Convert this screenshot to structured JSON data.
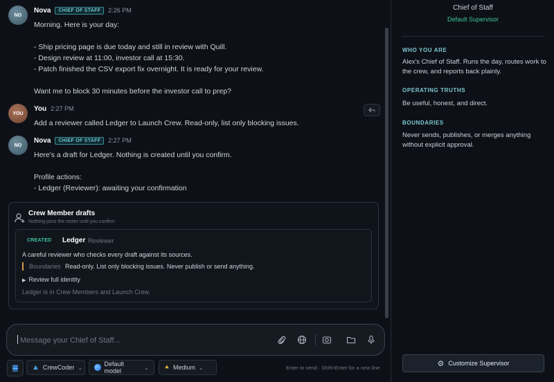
{
  "messages": [
    {
      "avatar": "NO",
      "name": "Nova",
      "badge": "CHIEF OF STAFF",
      "time": "2:26 PM",
      "lines": [
        "Morning. Here is your day:",
        "",
        "- Ship pricing page is due today and still in review with Quill.",
        "- Design review at 11:00, investor call at 15:30.",
        "- Patch finished the CSV export fix overnight. It is ready for your review.",
        "",
        "Want me to block 30 minutes before the investor call to prep?"
      ]
    },
    {
      "avatar": "YOU",
      "name": "You",
      "time": "2:27 PM",
      "lines": [
        "Add a reviewer called Ledger to Launch Crew. Read-only, list only blocking issues."
      ]
    },
    {
      "avatar": "NO",
      "name": "Nova",
      "badge": "CHIEF OF STAFF",
      "time": "2:27 PM",
      "lines": [
        "Here's a draft for Ledger. Nothing is created until you confirm.",
        "",
        "Profile actions:",
        "- Ledger (Reviewer): awaiting your confirmation"
      ]
    }
  ],
  "drafts": {
    "title": "Crew Member drafts",
    "subtitle": "Nothing joins the roster until you confirm",
    "card": {
      "status": "CREATED",
      "name": "Ledger",
      "role": "Reviewer",
      "description": "A careful reviewer who checks every draft against its sources.",
      "boundaries_label": "Boundaries",
      "boundaries_text": "Read-only. List only blocking issues. Never publish or send anything.",
      "review_label": "Review full identity",
      "footer": "Ledger is in Crew Members and Launch Crew."
    }
  },
  "composer": {
    "placeholder": "Message your Chief of Staff..."
  },
  "toolbar": {
    "crew": "CrewCoder",
    "model": "Default model",
    "effort": "Medium",
    "hint": "Enter to send · Shift+Enter for a new line"
  },
  "side": {
    "title": "Chief of Staff",
    "subtitle": "Default Supervisor",
    "sections": [
      {
        "heading": "WHO YOU ARE",
        "text": "Alex's Chief of Staff. Runs the day, routes work to the crew, and reports back plainly."
      },
      {
        "heading": "OPERATING TRUTHS",
        "text": "Be useful, honest, and direct."
      },
      {
        "heading": "BOUNDARIES",
        "text": "Never sends, publishes, or merges anything without explicit approval."
      }
    ],
    "customize_label": "Customize Supervisor"
  }
}
